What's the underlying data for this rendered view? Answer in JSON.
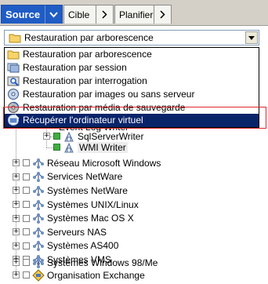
{
  "tabs": [
    {
      "label": "Source",
      "active": true
    },
    {
      "label": "Cible",
      "active": false
    },
    {
      "label": "Planifier",
      "active": false
    }
  ],
  "combo": {
    "value": "Restauration par arborescence",
    "icon": "folder-icon"
  },
  "dropdown": {
    "options": [
      {
        "label": "Restauration par arborescence",
        "icon": "folder-icon",
        "selected": false
      },
      {
        "label": "Restauration par session",
        "icon": "session-icon",
        "selected": false
      },
      {
        "label": "Restauration par interrogation",
        "icon": "query-icon",
        "selected": false
      },
      {
        "label": "Restauration par images ou sans serveur",
        "icon": "disk-image-icon",
        "selected": false
      },
      {
        "label": "Restauration par média de sauvegarde",
        "icon": "backup-media-icon",
        "selected": false
      },
      {
        "label": "Récupérer l'ordinateur virtuel",
        "icon": "virtual-machine-icon",
        "selected": true
      }
    ],
    "highlight_color": "#e0272d"
  },
  "tree": {
    "partial_label": "Event Log Writer",
    "sub_items": [
      {
        "label": "SqlServerWriter"
      },
      {
        "label": "WMI Writer"
      }
    ],
    "items": [
      {
        "label": "Réseau Microsoft Windows"
      },
      {
        "label": "Services NetWare"
      },
      {
        "label": "Systèmes NetWare"
      },
      {
        "label": "Systèmes UNIX/Linux"
      },
      {
        "label": "Systèmes Mac OS X"
      },
      {
        "label": "Serveurs NAS"
      },
      {
        "label": "Systèmes AS400"
      },
      {
        "label": "Systèmes VMS"
      },
      {
        "label": "Systèmes Windows 98/Me"
      },
      {
        "label": "Organisation Exchange"
      }
    ]
  },
  "colors": {
    "accent": "#1f5cc4",
    "selection": "#0a246a"
  }
}
